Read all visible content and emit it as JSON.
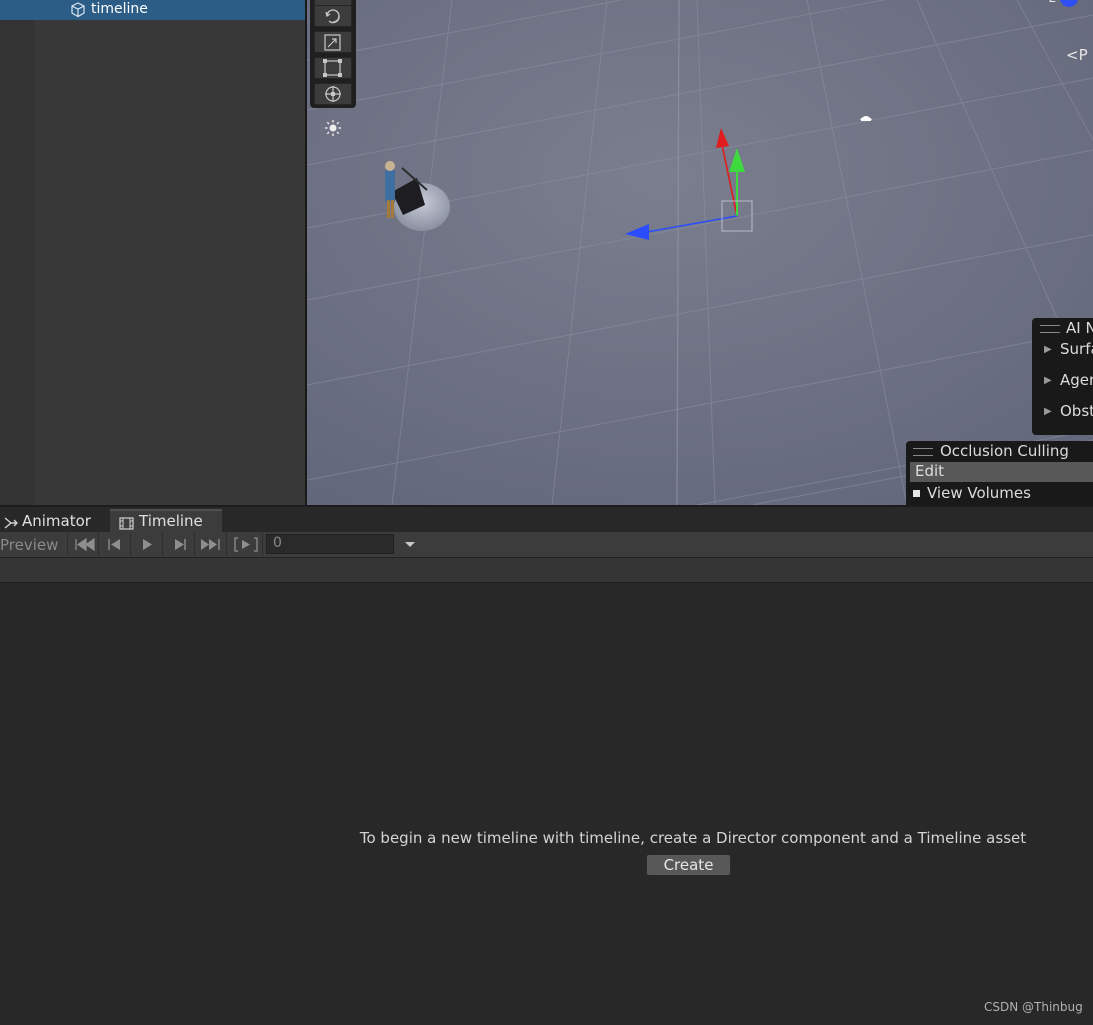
{
  "hierarchy": {
    "selected_item": "timeline"
  },
  "scene": {
    "overlays": {
      "ai_navigation": {
        "title": "AI N",
        "items": [
          "Surfa",
          "Ager",
          "Obst"
        ]
      },
      "occlusion_culling": {
        "title": "Occlusion Culling",
        "edit_label": "Edit",
        "view_volumes_label": "View Volumes"
      },
      "persp_label": "<P",
      "gizmo_axis_label": "z"
    },
    "colors": {
      "x_axis": "#e01c1c",
      "y_axis": "#3ed93e",
      "z_axis": "#2a4dff"
    }
  },
  "tabs": [
    {
      "label": "Animator"
    },
    {
      "label": "Timeline"
    }
  ],
  "timeline": {
    "preview_label": "Preview",
    "frame_value": "0",
    "message": "To begin a new timeline with timeline, create a Director component and a Timeline asset",
    "create_label": "Create"
  },
  "watermark": "CSDN @Thinbug"
}
